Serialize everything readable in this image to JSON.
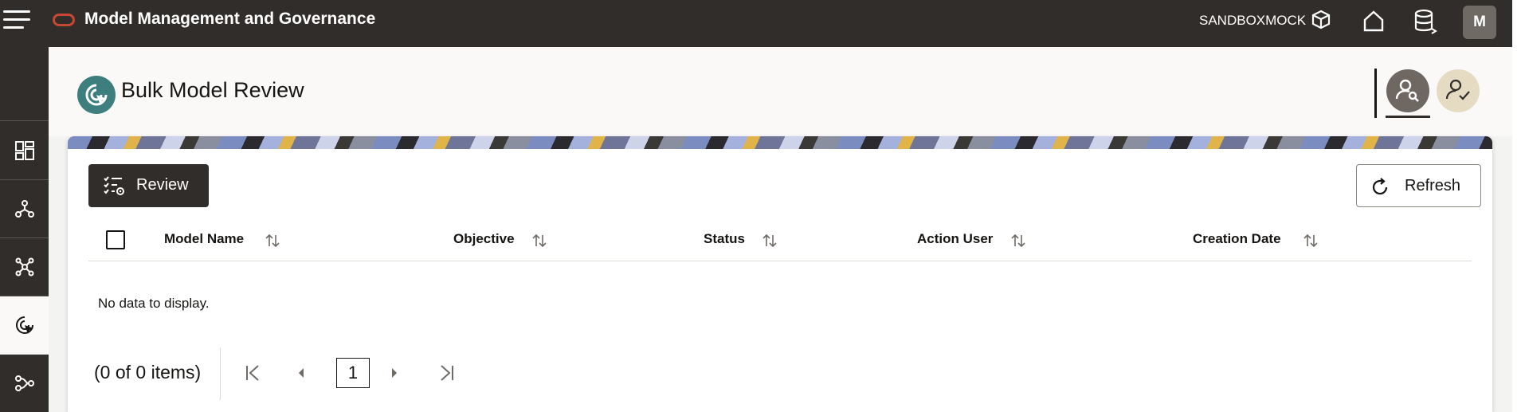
{
  "header": {
    "app_title": "Model Management and Governance",
    "workspace": "SANDBOXMOCK",
    "user_initial": "M",
    "icons": [
      "hamburger-icon",
      "oracle-logo",
      "workspace-cube-icon",
      "home-icon",
      "database-icon"
    ]
  },
  "left_rail": {
    "items": [
      {
        "name": "dashboard-icon",
        "active": false
      },
      {
        "name": "model-pipeline-icon",
        "active": false
      },
      {
        "name": "model-network-icon",
        "active": false
      },
      {
        "name": "bulk-review-icon",
        "active": true
      },
      {
        "name": "workflow-icon",
        "active": false
      }
    ]
  },
  "page": {
    "title": "Bulk Model Review",
    "mode_buttons": [
      "reviewer-search-icon",
      "approver-check-icon"
    ]
  },
  "toolbar": {
    "review_label": "Review",
    "refresh_label": "Refresh"
  },
  "table": {
    "columns": [
      "Model Name",
      "Objective",
      "Status",
      "Action User",
      "Creation Date"
    ],
    "rows": [],
    "empty_text": "No data to display."
  },
  "pagination": {
    "summary": "(0 of 0 items)",
    "current_page": "1"
  },
  "colors": {
    "topbar": "#312d2a",
    "accent_teal": "#3d7e7e",
    "oracle_red": "#c74634"
  }
}
